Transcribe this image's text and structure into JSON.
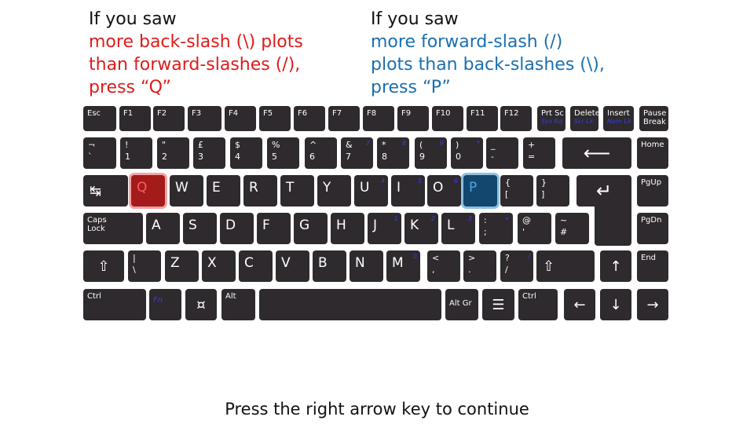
{
  "left_instruction": {
    "heading": "If you saw",
    "lines": [
      "more back-slash (\\) plots",
      "than forward-slashes (/),",
      "press “Q”"
    ],
    "color": "#e01b1b"
  },
  "right_instruction": {
    "heading": "If you saw",
    "lines": [
      "more forward-slash (/)",
      "plots than back-slashes (\\),",
      "press “P”"
    ],
    "color": "#1a6fb0"
  },
  "keyboard": {
    "row0": [
      "Esc",
      "F1",
      "F2",
      "F3",
      "F4",
      "F5",
      "F6",
      "F7",
      "F8",
      "F9",
      "F10",
      "F11",
      "F12"
    ],
    "prtsc": {
      "label": "Prt Sc",
      "sub": "Sys Rq"
    },
    "delete": {
      "label": "Delete",
      "sub": "Scr Lk"
    },
    "insert": {
      "label": "Insert",
      "sub": "Num Lk"
    },
    "pause": {
      "label": "Pause",
      "label2": "Break"
    },
    "num": [
      {
        "sh": "¬",
        "un": "`"
      },
      {
        "sh": "!",
        "un": "1"
      },
      {
        "sh": "\"",
        "un": "2"
      },
      {
        "sh": "£",
        "un": "3"
      },
      {
        "sh": "$",
        "un": "4"
      },
      {
        "sh": "%",
        "un": "5"
      },
      {
        "sh": "^",
        "un": "6"
      },
      {
        "sh": "&",
        "un": "7",
        "alt": "7"
      },
      {
        "sh": "*",
        "un": "8",
        "alt": "8"
      },
      {
        "sh": "(",
        "un": "9",
        "alt": "9"
      },
      {
        "sh": ")",
        "un": "0",
        "alt": "*"
      },
      {
        "sh": "_",
        "un": "-"
      },
      {
        "sh": "+",
        "un": "="
      }
    ],
    "home": "Home",
    "qrow": [
      {
        "k": "Q"
      },
      {
        "k": "W"
      },
      {
        "k": "E"
      },
      {
        "k": "R"
      },
      {
        "k": "T"
      },
      {
        "k": "Y"
      },
      {
        "k": "U",
        "alt": "4"
      },
      {
        "k": "I",
        "alt": "5"
      },
      {
        "k": "O",
        "alt": "6"
      },
      {
        "k": "P",
        "alt": "-"
      }
    ],
    "bracket_l": {
      "sh": "{",
      "un": "["
    },
    "bracket_r": {
      "sh": "}",
      "un": "]"
    },
    "pgup": "PgUp",
    "caps": {
      "l1": "Caps",
      "l2": "Lock"
    },
    "arow": [
      {
        "k": "A"
      },
      {
        "k": "S"
      },
      {
        "k": "D"
      },
      {
        "k": "F"
      },
      {
        "k": "G"
      },
      {
        "k": "H"
      },
      {
        "k": "J",
        "alt": "1"
      },
      {
        "k": "K",
        "alt": "2"
      },
      {
        "k": "L",
        "alt": "3"
      }
    ],
    "semi": {
      "sh": ":",
      "un": ";",
      "alt": "+"
    },
    "at": {
      "sh": "@",
      "un": "'"
    },
    "hash": {
      "sh": "~",
      "un": "#"
    },
    "pgdn": "PgDn",
    "backslash": {
      "sh": "|",
      "un": "\\"
    },
    "zrow": [
      {
        "k": "Z"
      },
      {
        "k": "X"
      },
      {
        "k": "C"
      },
      {
        "k": "V"
      },
      {
        "k": "B"
      },
      {
        "k": "N"
      },
      {
        "k": "M",
        "alt": "0"
      }
    ],
    "comma": {
      "sh": "<",
      "un": ","
    },
    "period": {
      "sh": ">",
      "un": ".",
      "alt": "."
    },
    "slash": {
      "sh": "?",
      "un": "/",
      "alt": "/"
    },
    "end": "End",
    "ctrl": "Ctrl",
    "fn": "Fn",
    "alt": "Alt",
    "altgr": "Alt Gr",
    "ctrl_r": "Ctrl",
    "icons": {
      "backspace": "⟵",
      "tab": "↹",
      "enter": "↵",
      "shift": "⇧",
      "up": "↑",
      "down": "↓",
      "left": "←",
      "right": "→",
      "win": "¤",
      "menu": "☰"
    },
    "highlight_q": "#a31b1b",
    "highlight_p": "#13476e"
  },
  "footer": "Press the right arrow key to continue"
}
